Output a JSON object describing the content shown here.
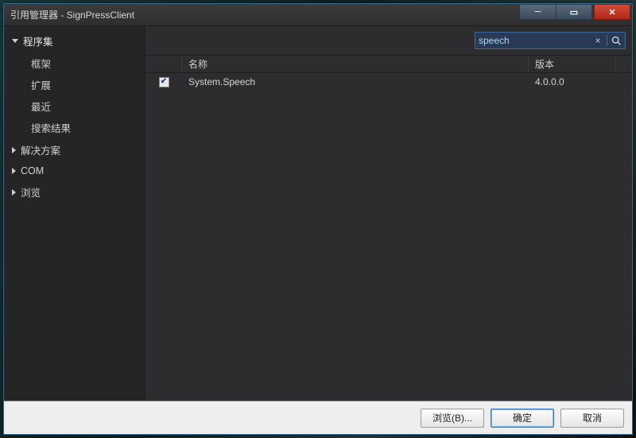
{
  "titlebar": {
    "caption": "引用管理器 - SignPressClient"
  },
  "search": {
    "value": "speech"
  },
  "sidebar": {
    "groups": [
      {
        "label": "程序集",
        "expanded": true,
        "subitems": [
          "框架",
          "扩展",
          "最近",
          "搜索结果"
        ]
      },
      {
        "label": "解决方案",
        "expanded": false
      },
      {
        "label": "COM",
        "expanded": false
      },
      {
        "label": "浏览",
        "expanded": false
      }
    ]
  },
  "list": {
    "columns": {
      "name": "名称",
      "version": "版本"
    },
    "rows": [
      {
        "checked": true,
        "name": "System.Speech",
        "version": "4.0.0.0"
      }
    ]
  },
  "footer": {
    "browse": "浏览(B)...",
    "ok": "确定",
    "cancel": "取消"
  }
}
